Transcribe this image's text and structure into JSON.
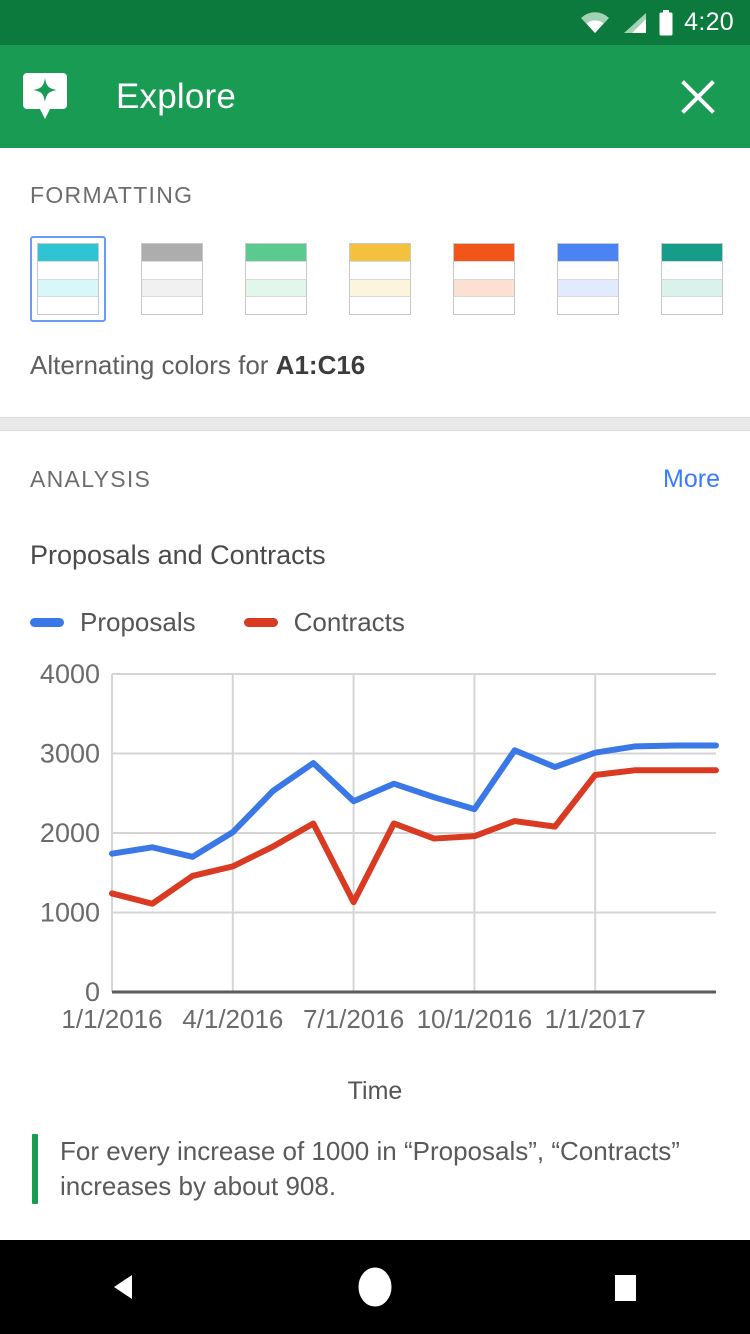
{
  "status_bar": {
    "time": "4:20",
    "icons": [
      "wifi-icon",
      "cell-signal-icon",
      "battery-icon"
    ]
  },
  "app_bar": {
    "icon": "explore-sparkle-icon",
    "title": "Explore",
    "close_icon": "close-icon"
  },
  "formatting": {
    "heading": "FORMATTING",
    "swatches": [
      {
        "name": "cyan",
        "header": "#2ec4d4",
        "alt": "#d9f6fb",
        "selected": true
      },
      {
        "name": "grey",
        "header": "#adadad",
        "alt": "#f1f1f1",
        "selected": false
      },
      {
        "name": "green",
        "header": "#5bca8e",
        "alt": "#e3f6eb",
        "selected": false
      },
      {
        "name": "yellow",
        "header": "#f4c13e",
        "alt": "#fdf4dd",
        "selected": false
      },
      {
        "name": "orange",
        "header": "#f2551a",
        "alt": "#fce0d6",
        "selected": false
      },
      {
        "name": "blue",
        "header": "#4c83f2",
        "alt": "#e2eaft",
        "selected": false
      },
      {
        "name": "teal",
        "header": "#159d8a",
        "alt": "#dcf0ec",
        "selected": false
      }
    ],
    "caption_prefix": "Alternating colors for ",
    "caption_range": "A1:C16",
    "selected_border_color": "#6a9bfa"
  },
  "analysis": {
    "heading": "ANALYSIS",
    "more_label": "More",
    "insight": "For every increase of 1000 in “Proposals”, “Contracts” increases by about 908.",
    "insight_bar_color": "#1a9b54"
  },
  "nav_bar": {
    "back_icon": "back-triangle-icon",
    "home_icon": "home-circle-icon",
    "recents_icon": "recents-square-icon"
  },
  "chart_data": {
    "type": "line",
    "title": "Proposals and Contracts",
    "xlabel": "Time",
    "ylabel": "",
    "ylim": [
      0,
      4000
    ],
    "yticks": [
      0,
      1000,
      2000,
      3000,
      4000
    ],
    "xtick_labels": [
      "1/1/2016",
      "4/1/2016",
      "7/1/2016",
      "10/1/2016",
      "1/1/2017"
    ],
    "xtick_indices": [
      0,
      3,
      6,
      9,
      12
    ],
    "grid": true,
    "legend_position": "top-left",
    "x": [
      "1/1/2016",
      "2/1/2016",
      "3/1/2016",
      "4/1/2016",
      "5/1/2016",
      "6/1/2016",
      "7/1/2016",
      "8/1/2016",
      "9/1/2016",
      "10/1/2016",
      "11/1/2016",
      "12/1/2016",
      "1/1/2017",
      "2/1/2017",
      "3/1/2017",
      "4/1/2017"
    ],
    "series": [
      {
        "name": "Proposals",
        "color": "#3b78e7",
        "values": [
          1740,
          1820,
          1700,
          2010,
          2530,
          2880,
          2400,
          2620,
          2450,
          2300,
          3040,
          2830,
          3010,
          3090,
          3100,
          3100
        ]
      },
      {
        "name": "Contracts",
        "color": "#d93a21",
        "values": [
          1240,
          1110,
          1460,
          1580,
          1830,
          2120,
          1130,
          2120,
          1930,
          1960,
          2150,
          2080,
          2730,
          2790,
          2790,
          2790
        ]
      }
    ]
  }
}
